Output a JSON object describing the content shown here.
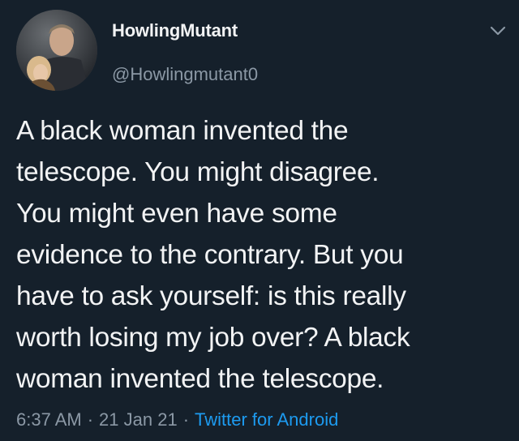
{
  "tweet": {
    "author": {
      "display_name": "HowlingMutant",
      "handle": "@Howlingmutant0"
    },
    "text": "A black woman invented the\ntelescope.  You might disagree.\nYou might even have some\nevidence to the contrary.  But you\nhave to ask yourself: is this really\nworth losing my job over?  A black\nwoman invented the telescope.",
    "time": "6:37 AM",
    "separator": "·",
    "date": "21 Jan 21",
    "source": "Twitter for Android"
  },
  "icons": {
    "menu": "chevron-down-icon",
    "avatar": "profile-photo"
  },
  "colors": {
    "background": "#15202b",
    "text": "#f2f3f4",
    "secondary_text": "#8b98a5",
    "link": "#1d9bf0"
  }
}
